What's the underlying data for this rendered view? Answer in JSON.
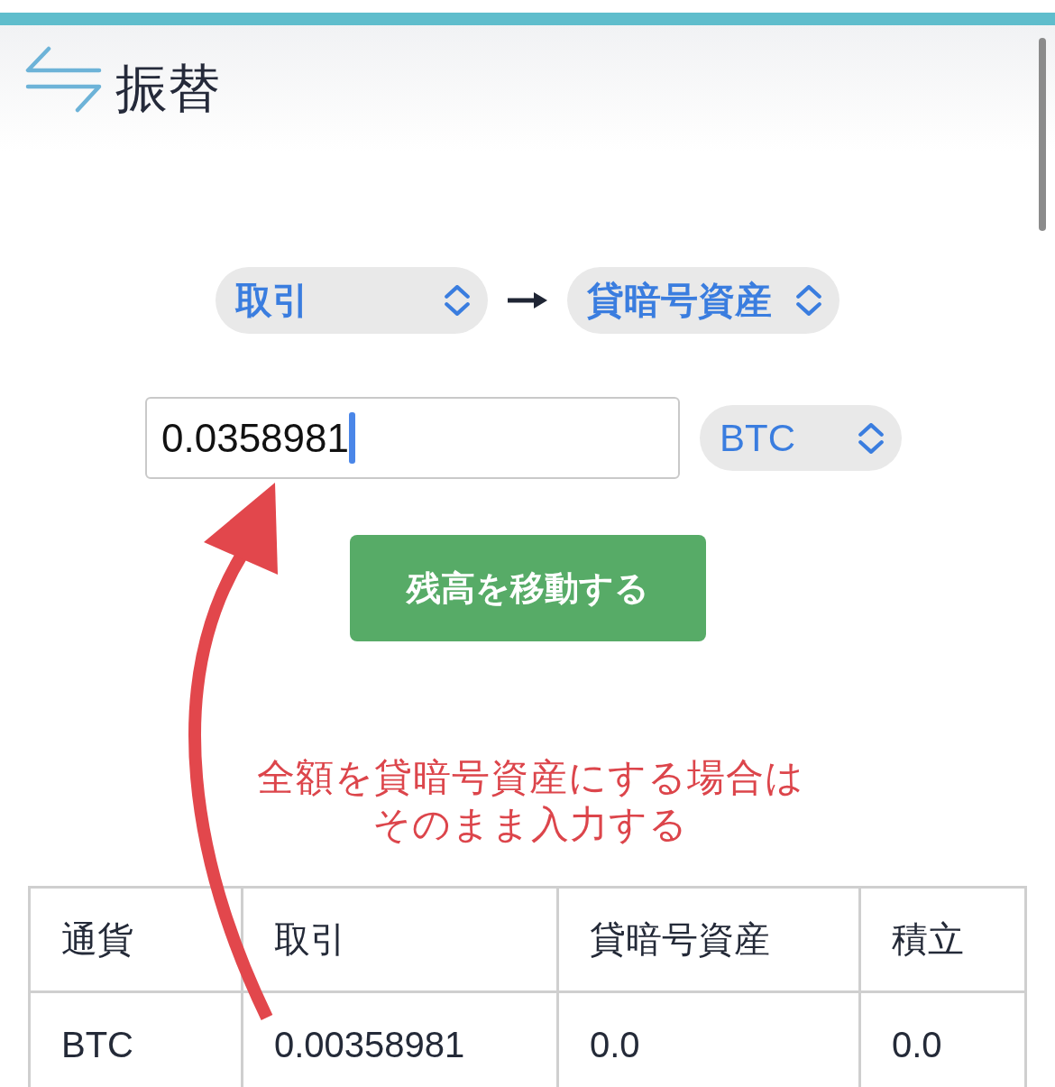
{
  "header": {
    "title": "振替"
  },
  "transfer": {
    "from": {
      "label": "取引"
    },
    "to": {
      "label": "貸暗号資産"
    }
  },
  "amount": {
    "value": "0.0358981",
    "focused": true
  },
  "currency": {
    "label": "BTC"
  },
  "submit_button": {
    "label": "残高を移動する"
  },
  "annotation": {
    "lines": [
      "全額を貸暗号資産にする場合は",
      "そのまま入力する"
    ]
  },
  "table": {
    "columns": [
      "通貨",
      "取引",
      "貸暗号資産",
      "積立"
    ],
    "rows": [
      [
        "BTC",
        "0.00358981",
        "0.0",
        "0.0"
      ]
    ]
  }
}
